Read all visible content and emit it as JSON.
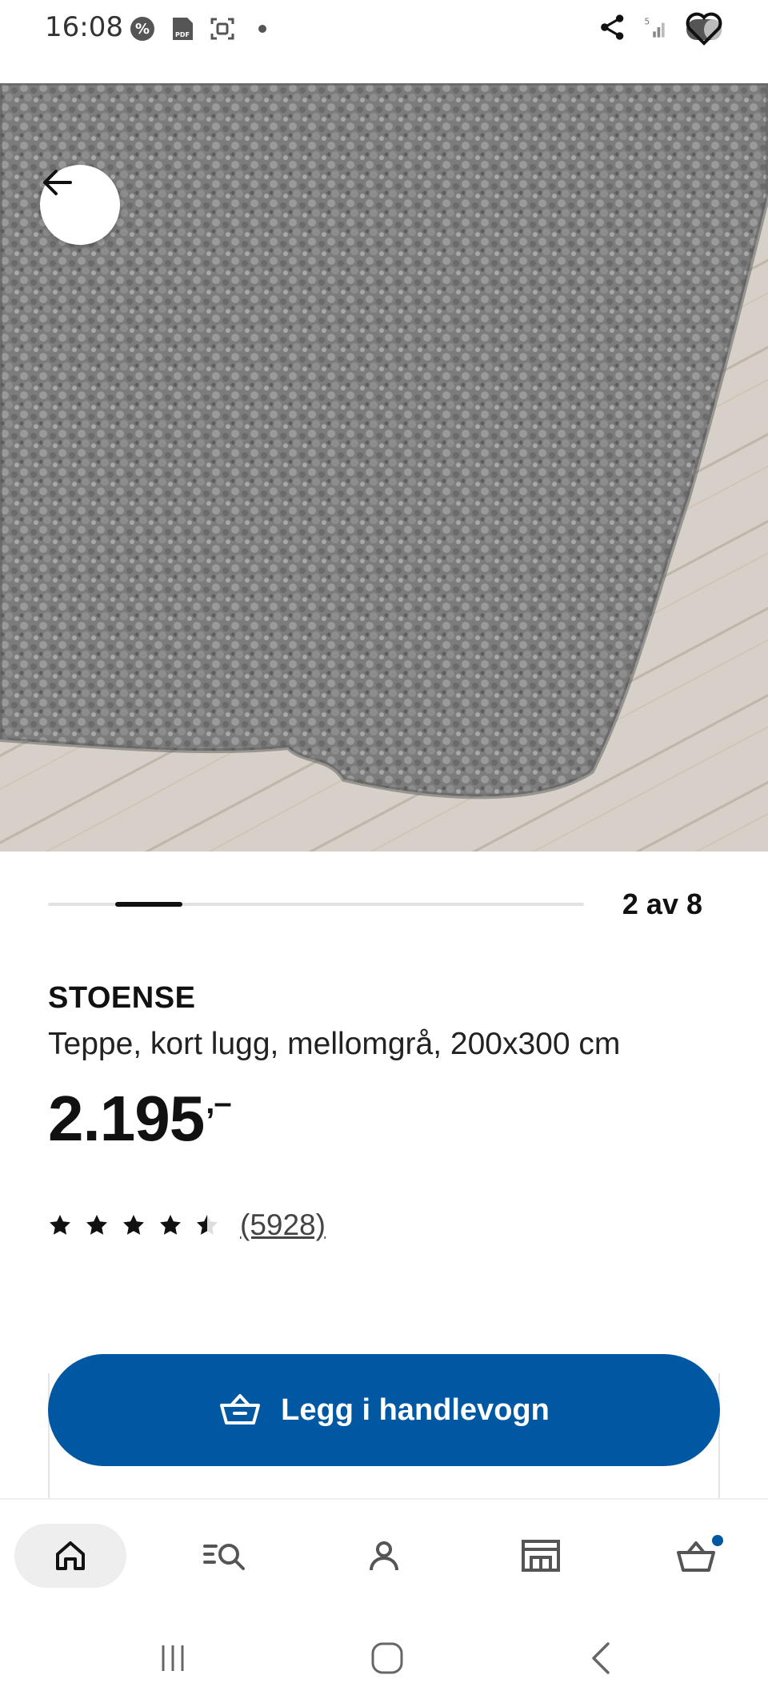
{
  "status_bar": {
    "time": "16:08",
    "left_icons": [
      "percent-icon",
      "pdf-icon",
      "screenshot-icon",
      "dot-icon"
    ],
    "right_icons": [
      "share-icon",
      "signal-icon",
      "battery-icon",
      "heart-icon"
    ],
    "signal_label": "5"
  },
  "hero": {
    "image": "grey-shag-rug-photo"
  },
  "carousel": {
    "counter": "2 av 8",
    "position_fraction": 0.25
  },
  "product": {
    "name": "STOENSE",
    "description": "Teppe, kort lugg, mellomgrå, 200x300 cm",
    "price": "2.195",
    "price_suffix": ",–",
    "rating_value": 4.5,
    "rating_max": 5,
    "review_count": "(5928)"
  },
  "cart": {
    "button_label": "Legg i handlevogn",
    "icon": "basket-icon",
    "color": "#0058a3"
  },
  "bottom_nav": {
    "items": [
      {
        "name": "home",
        "icon": "home-icon",
        "active": true
      },
      {
        "name": "search",
        "icon": "search-list-icon",
        "active": false
      },
      {
        "name": "profile",
        "icon": "person-icon",
        "active": false
      },
      {
        "name": "store",
        "icon": "store-icon",
        "active": false
      },
      {
        "name": "cart",
        "icon": "cart-icon",
        "active": false,
        "badge": true
      }
    ]
  },
  "system_nav": {
    "buttons": [
      "recent-apps",
      "home",
      "back"
    ]
  }
}
